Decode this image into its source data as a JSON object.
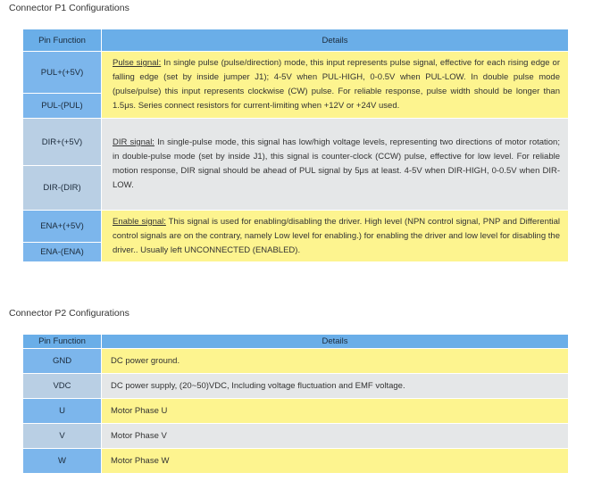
{
  "p1": {
    "title": "Connector P1 Configurations",
    "headers": {
      "pin": "Pin Function",
      "details": "Details"
    },
    "rows": [
      {
        "pins": [
          "PUL+(+5V)",
          "PUL-(PUL)"
        ],
        "signal": "Pulse signal:",
        "text": " In single pulse (pulse/direction) mode, this input represents pulse signal, effective for each rising edge or falling edge (set by inside jumper J1); 4-5V when PUL-HIGH, 0-0.5V when PUL-LOW. In double pulse mode (pulse/pulse) this input represents clockwise (CW) pulse. For reliable response, pulse width should be longer than 1.5μs. Series connect resistors for current-limiting when +12V or +24V used."
      },
      {
        "pins": [
          "DIR+(+5V)",
          "DIR-(DIR)"
        ],
        "signal": "DIR signal:",
        "text": " In single-pulse mode, this signal has low/high voltage levels, representing two directions of motor rotation; in double-pulse mode (set by inside J1), this signal is counter-clock (CCW) pulse, effective for low level. For reliable motion response, DIR signal should be ahead of PUL signal by 5μs at least. 4-5V when DIR-HIGH, 0-0.5V when DIR-LOW."
      },
      {
        "pins": [
          "ENA+(+5V)",
          "ENA-(ENA)"
        ],
        "signal": "Enable signal:",
        "text": " This signal is used for enabling/disabling the driver. High level (NPN control signal, PNP and Differential control signals are on the contrary, namely Low level for enabling.) for enabling the driver and low level for disabling the driver.. Usually left UNCONNECTED (ENABLED)."
      }
    ]
  },
  "p2": {
    "title": "Connector P2 Configurations",
    "headers": {
      "pin": "Pin Function",
      "details": "Details"
    },
    "rows": [
      {
        "pin": "GND",
        "details": "DC power ground."
      },
      {
        "pin": "VDC",
        "details": "DC power supply, (20~50)VDC, Including voltage fluctuation and EMF voltage."
      },
      {
        "pin": "U",
        "details": "Motor Phase U"
      },
      {
        "pin": "V",
        "details": "Motor Phase V"
      },
      {
        "pin": "W",
        "details": "Motor Phase W"
      }
    ]
  }
}
